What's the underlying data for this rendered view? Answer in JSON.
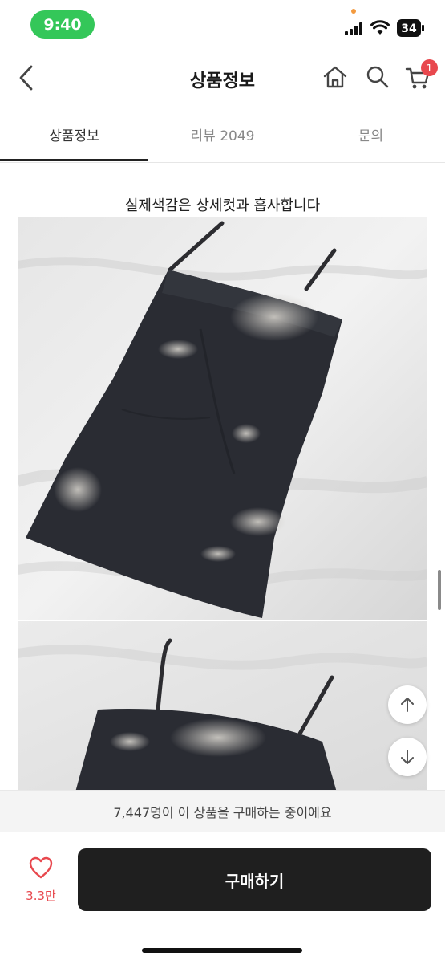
{
  "status_bar": {
    "time": "9:40",
    "battery_level": "34",
    "icons": [
      "signal-icon",
      "wifi-icon",
      "battery-icon"
    ]
  },
  "header": {
    "title": "상품정보",
    "icons": [
      "back-icon",
      "home-icon",
      "search-icon",
      "cart-icon"
    ],
    "cart_badge": "1"
  },
  "tabs": [
    {
      "label": "상품정보",
      "active": true
    },
    {
      "label": "리뷰 2049",
      "active": false
    },
    {
      "label": "문의",
      "active": false
    }
  ],
  "content": {
    "caption": "실제색감은 상세컷과 흡사합니다"
  },
  "floating_buttons": [
    "arrow-up-icon",
    "arrow-down-icon"
  ],
  "bottom": {
    "purchase_notice": "7,447명이 이 상품을 구매하는 중이에요",
    "like_count": "3.3만",
    "buy_label": "구매하기"
  },
  "colors": {
    "status_pill": "#34c759",
    "badge": "#e8484e",
    "buy_button": "#1f1f1f"
  }
}
